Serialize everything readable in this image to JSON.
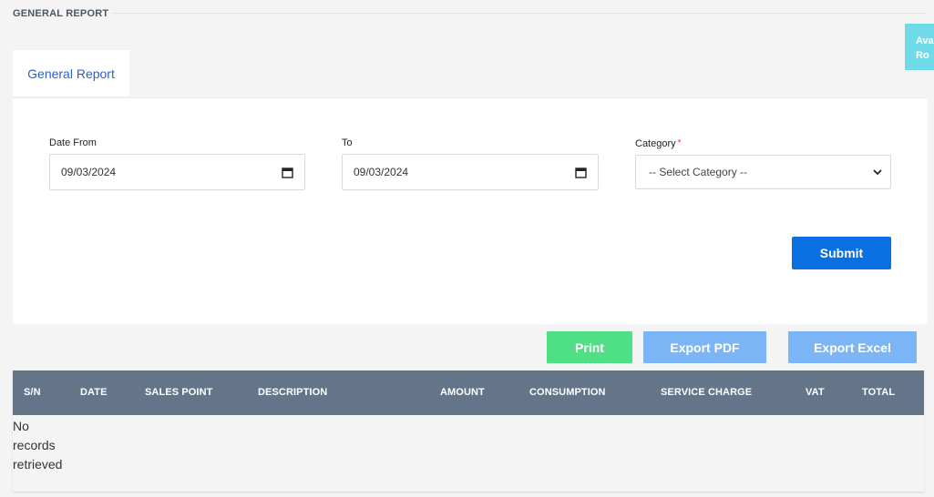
{
  "header": {
    "section_title": "GENERAL REPORT",
    "side_tab_text": "Ava Ro"
  },
  "tabs": [
    {
      "label": "General Report",
      "active": true
    }
  ],
  "form": {
    "date_from": {
      "label": "Date From",
      "value": "09/03/2024",
      "icon": "calendar-icon"
    },
    "date_to": {
      "label": "To",
      "value": "09/03/2024",
      "icon": "calendar-icon"
    },
    "category": {
      "label": "Category",
      "required_mark": "*",
      "selected": "-- Select Category --",
      "icon": "chevron-down-icon"
    },
    "submit_label": "Submit"
  },
  "actions": {
    "print_label": "Print",
    "export_pdf_label": "Export PDF",
    "export_excel_label": "Export Excel"
  },
  "table": {
    "columns": [
      "S/N",
      "DATE",
      "SALES POINT",
      "DESCRIPTION",
      "AMOUNT",
      "CONSUMPTION",
      "SERVICE CHARGE",
      "VAT",
      "TOTAL"
    ],
    "empty_message": "No records retrieved",
    "rows": []
  },
  "colors": {
    "primary": "#0a6fe0",
    "print": "#4fe085",
    "export": "#7cb5f6",
    "table_header": "#647589",
    "tab_text": "#2662c9",
    "side_tab": "#6fdbe8"
  }
}
